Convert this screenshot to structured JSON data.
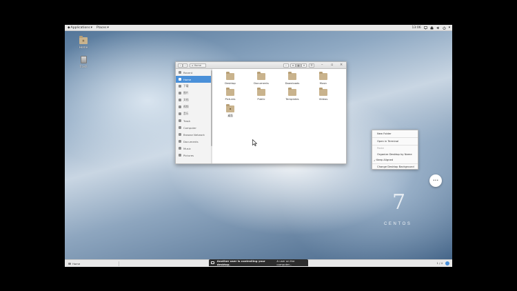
{
  "top_panel": {
    "applications_label": "Applications",
    "places_label": "Places",
    "clock": "13:06",
    "icons": [
      "display-icon",
      "network-icon",
      "volume-icon",
      "power-icon",
      "chevron-down-icon"
    ]
  },
  "desktop": {
    "icons": [
      {
        "label": "Home",
        "icon": "folder-home-icon"
      },
      {
        "label": "Trash",
        "icon": "trash-icon"
      }
    ]
  },
  "file_manager": {
    "path_label": "Home",
    "sidebar": [
      {
        "label": "Recent",
        "icon": "clock-icon",
        "active": false
      },
      {
        "label": "Home",
        "icon": "home-icon",
        "active": true
      },
      {
        "label": "下载",
        "icon": "download-icon",
        "active": false
      },
      {
        "label": "图片",
        "icon": "picture-icon",
        "active": false
      },
      {
        "label": "文档",
        "icon": "document-icon",
        "active": false
      },
      {
        "label": "视频",
        "icon": "video-icon",
        "active": false
      },
      {
        "label": "音乐",
        "icon": "music-icon",
        "active": false
      },
      {
        "label": "Trash",
        "icon": "trash-icon",
        "active": false
      },
      {
        "label": "Computer",
        "icon": "computer-icon",
        "active": false
      },
      {
        "label": "Browse Network",
        "icon": "network-icon",
        "active": false
      },
      {
        "label": "Documents",
        "icon": "folder-icon",
        "active": false
      },
      {
        "label": "Music",
        "icon": "folder-icon",
        "active": false
      },
      {
        "label": "Pictures",
        "icon": "folder-icon",
        "active": false
      }
    ],
    "files": [
      {
        "name": "Desktop"
      },
      {
        "name": "Documents"
      },
      {
        "name": "Downloads"
      },
      {
        "name": "Music"
      },
      {
        "name": "Pictures"
      },
      {
        "name": "Public"
      },
      {
        "name": "Templates"
      },
      {
        "name": "Videos"
      },
      {
        "name": "桌面"
      }
    ]
  },
  "context_menu": {
    "items": [
      {
        "label": "New Folder",
        "enabled": true
      },
      {
        "label": "Open in Terminal",
        "enabled": true
      },
      {
        "label": "Paste",
        "enabled": false
      },
      {
        "label": "Organize Desktop by Name",
        "enabled": true
      },
      {
        "label": "Keep Aligned",
        "enabled": true,
        "checked": true
      },
      {
        "label": "Change Desktop Background",
        "enabled": true
      }
    ]
  },
  "bubble_label": "...",
  "branding": {
    "logo_number": "7",
    "logo_text": "CENTOS"
  },
  "bottom_panel": {
    "task_label": "Home",
    "workspace": "1 / 4"
  },
  "notification": {
    "title": "Another user is controlling your desktop.",
    "body": "A user on the computer..."
  },
  "colors": {
    "selection": "#4a90d9",
    "panel": "#e9e9e9",
    "notice_bg": "#2d2d2d"
  }
}
